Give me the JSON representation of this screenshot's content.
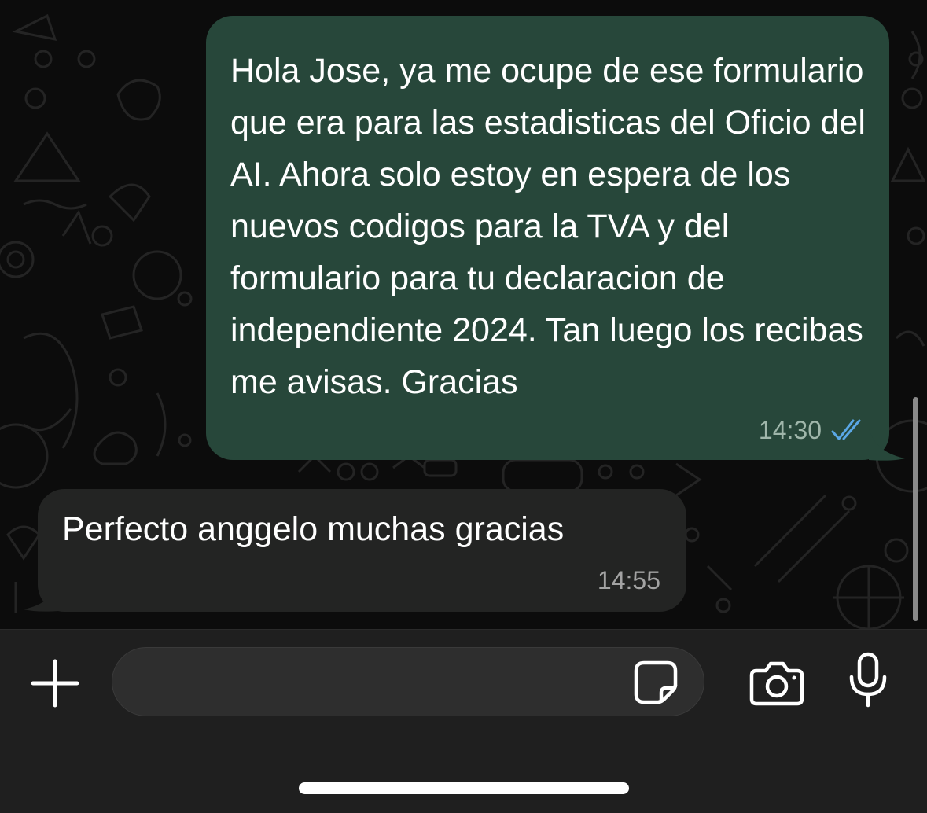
{
  "conversation": {
    "messages": [
      {
        "direction": "outgoing",
        "text": "Hola Jose, ya me ocupe de ese formulario que era para las estadisticas del Oficio del AI. Ahora solo estoy en espera de los nuevos codigos para la TVA y del formulario para tu declaracion de independiente 2024. Tan luego los recibas me avisas. Gracias",
        "time": "14:30",
        "status_icon": "double-check-read-icon",
        "status_color": "#5aa7e6"
      },
      {
        "direction": "incoming",
        "text": "Perfecto anggelo muchas gracias",
        "time": "14:55"
      }
    ]
  },
  "composer": {
    "input_value": "",
    "icons": {
      "attach": "plus-icon",
      "sticker": "sticker-icon",
      "camera": "camera-icon",
      "voice": "microphone-icon"
    }
  },
  "colors": {
    "outgoing_bubble": "#27473a",
    "incoming_bubble": "#232423",
    "chat_background": "#0c0c0c",
    "composer_background": "#1f1f1f"
  }
}
